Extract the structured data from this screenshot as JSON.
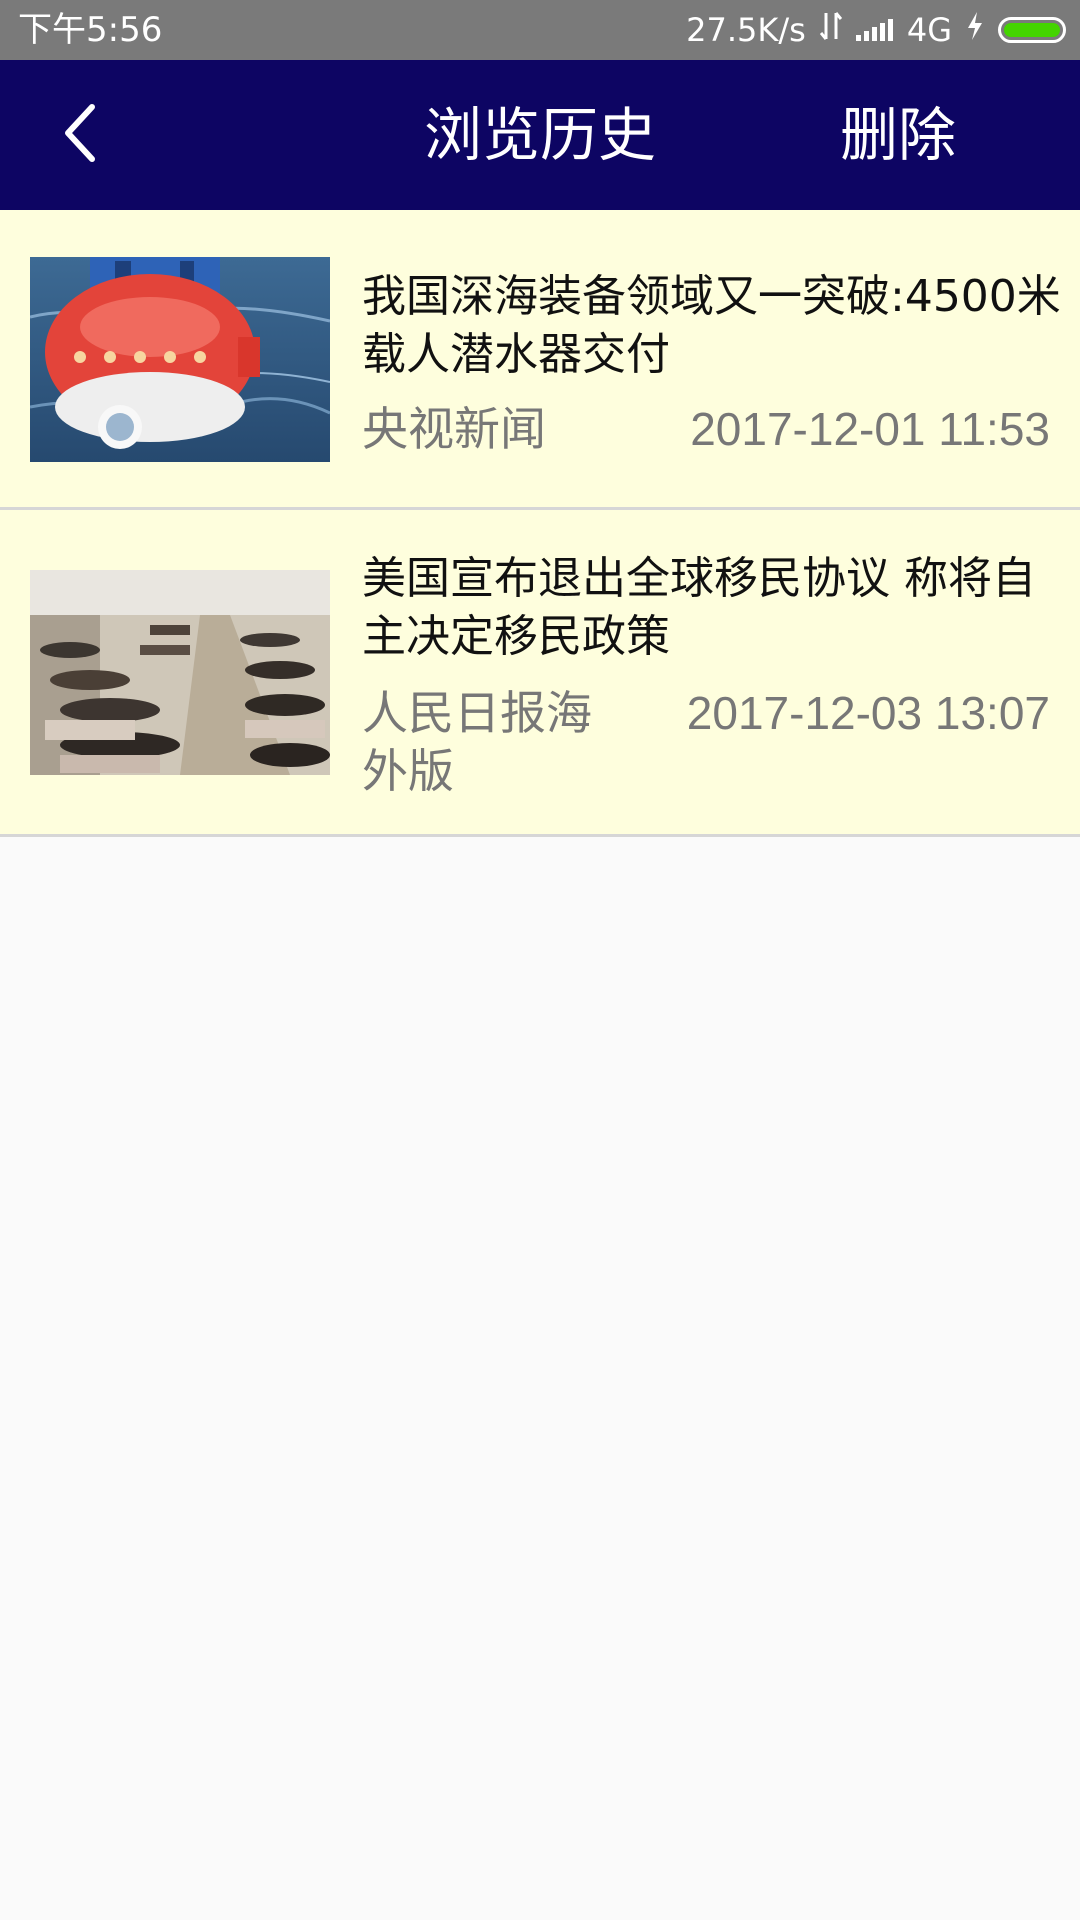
{
  "status_bar": {
    "time": "下午5:56",
    "network_speed": "27.5K/s",
    "network_type": "4G",
    "battery_color": "#44d400"
  },
  "header": {
    "title": "浏览历史",
    "delete_label": "删除",
    "back_icon": "chevron-left-icon",
    "background_color": "#0d0563"
  },
  "history": [
    {
      "title": "我国深海装备领域又一突破:4500米载人潜水器交付",
      "source": "央视新闻",
      "time": "2017-12-01 11:53"
    },
    {
      "title": "美国宣布退出全球移民协议 称将自主决定移民政策",
      "source": "人民日报海外版",
      "time": "2017-12-03 13:07"
    }
  ]
}
